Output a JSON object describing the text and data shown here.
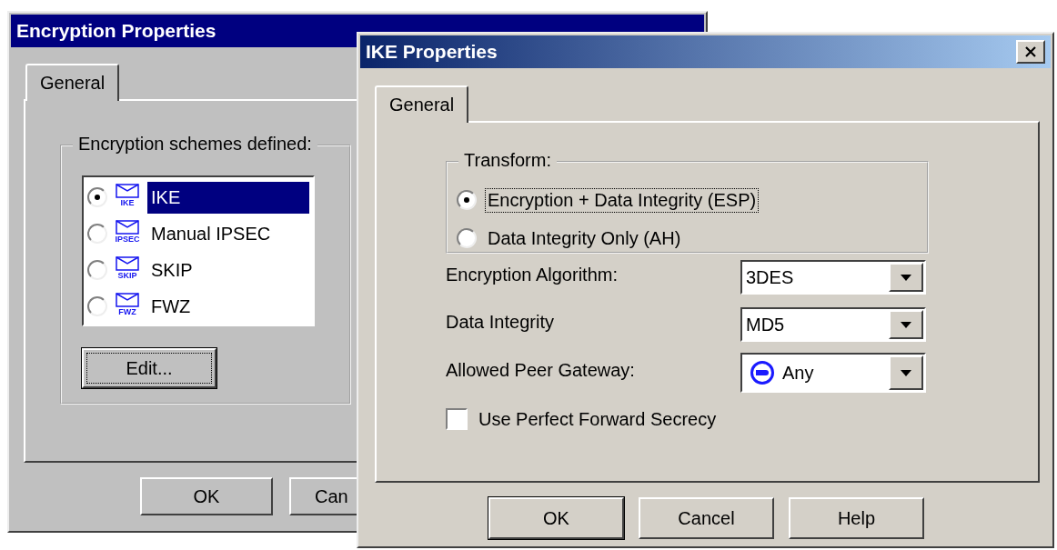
{
  "windows": [
    {
      "title": "Encryption Properties",
      "tabs": [
        {
          "label": "General",
          "selected": true
        }
      ],
      "group_label": "Encryption schemes defined:",
      "schemes": [
        {
          "label": "IKE",
          "badge": "IKE",
          "selected": true
        },
        {
          "label": "Manual IPSEC",
          "badge": "IPSEC",
          "selected": false
        },
        {
          "label": "SKIP",
          "badge": "SKIP",
          "selected": false
        },
        {
          "label": "FWZ",
          "badge": "FWZ",
          "selected": false
        }
      ],
      "edit_button": "Edit...",
      "buttons": [
        "OK",
        "Can"
      ]
    },
    {
      "title": "IKE Properties",
      "tabs": [
        {
          "label": "General",
          "selected": true
        }
      ],
      "transform": {
        "label": "Transform:",
        "options": [
          {
            "label": "Encryption + Data Integrity (ESP)",
            "selected": true
          },
          {
            "label": "Data Integrity Only (AH)",
            "selected": false
          }
        ]
      },
      "fields": [
        {
          "label": "Encryption Algorithm:",
          "value": "3DES",
          "kind": "plain"
        },
        {
          "label": "Data Integrity",
          "value": "MD5",
          "kind": "plain"
        },
        {
          "label": "Allowed Peer Gateway:",
          "value": "Any",
          "kind": "gateway"
        }
      ],
      "pfs": {
        "label": "Use Perfect Forward Secrecy",
        "checked": false
      },
      "buttons": [
        "OK",
        "Cancel",
        "Help"
      ]
    }
  ]
}
